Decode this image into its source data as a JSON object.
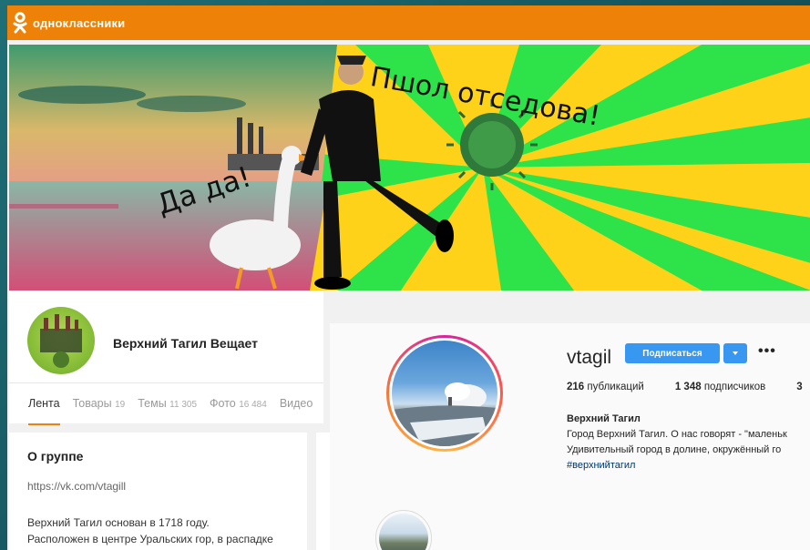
{
  "ok": {
    "brand": "одноклассники",
    "banner": {
      "caption_top": "Пшол отседова!",
      "caption_left": "Да да!"
    },
    "group": {
      "name": "Верхний Тагил Вещает",
      "tabs": [
        {
          "label": "Лента",
          "count": ""
        },
        {
          "label": "Товары",
          "count": "19"
        },
        {
          "label": "Темы",
          "count": "11 305"
        },
        {
          "label": "Фото",
          "count": "16 484"
        },
        {
          "label": "Видео",
          "count": ""
        }
      ]
    },
    "about": {
      "title": "О группе",
      "link": "https://vk.com/vtagill",
      "text_line1": "Верхний Тагил основан в 1718 году.",
      "text_line2": "Расположен в центре Уральских гор, в распадке"
    }
  },
  "ig": {
    "username": "vtagil",
    "follow_label": "Подписаться",
    "more_label": "•••",
    "stats": {
      "posts_count": "216",
      "posts_label": "публикаций",
      "followers_count": "1 348",
      "followers_label": "подписчиков",
      "following_count": "3"
    },
    "bio": {
      "name": "Верхний Тагил",
      "line1": "Город Верхний Тагил. О нас говорят - \"маленьк",
      "line2": "Удивительный город в долине, окружённый го",
      "tag": "#верхнийтагил"
    }
  },
  "colors": {
    "ok_orange": "#ee8208",
    "ig_blue": "#3897f0"
  }
}
